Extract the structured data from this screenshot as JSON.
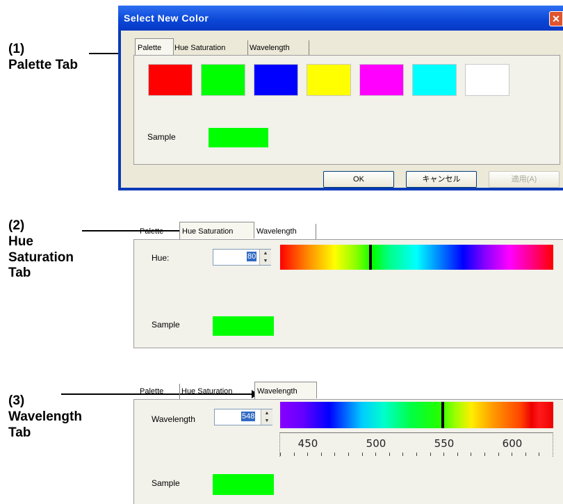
{
  "annotations": {
    "a1_num": "(1)",
    "a1_line1": "Palette Tab",
    "a2_num": "(2)",
    "a2_line1": "Hue",
    "a2_line2": "Saturation",
    "a2_line3": "Tab",
    "a3_num": "(3)",
    "a3_line1": "Wavelength",
    "a3_line2": "Tab"
  },
  "dialog": {
    "title": "Select New Color",
    "close_glyph": "✕",
    "tabs": [
      "Palette",
      "Hue Saturation",
      "Wavelength"
    ],
    "palette_colors": [
      "#ff0000",
      "#00ff00",
      "#0000ff",
      "#ffff00",
      "#ff00ff",
      "#00ffff",
      "#ffffff"
    ],
    "sample_label": "Sample",
    "sample_color": "#00ff00",
    "buttons": {
      "ok": "OK",
      "cancel": "キャンセル",
      "apply": "適用(A)"
    }
  },
  "hue_panel": {
    "tabs": [
      "Palette",
      "Hue Saturation",
      "Wavelength"
    ],
    "hue_label": "Hue:",
    "hue_value": "80",
    "hue_marker_fraction": 0.33,
    "sample_label": "Sample",
    "sample_color": "#00ff00"
  },
  "wave_panel": {
    "tabs": [
      "Palette",
      "Hue Saturation",
      "Wavelength"
    ],
    "wavelength_label": "Wavelength",
    "wavelength_value": "548",
    "wavelength_marker_fraction": 0.595,
    "scale_labels": [
      "450",
      "500",
      "550",
      "600"
    ],
    "sample_label": "Sample",
    "sample_color": "#00ff00"
  },
  "icons": {
    "spin_up": "▲",
    "spin_down": "▼"
  }
}
